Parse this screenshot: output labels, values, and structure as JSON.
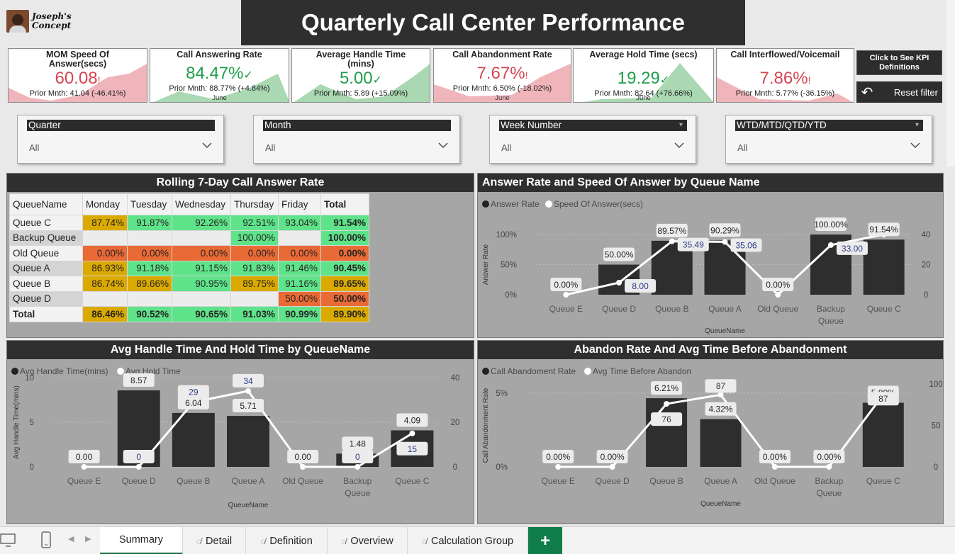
{
  "header": {
    "logo_text_line1": "Joseph's",
    "logo_text_line2": "Concept",
    "title": "Quarterly Call Center Performance"
  },
  "kpis": [
    {
      "title": "MOM Speed Of Answer(secs)",
      "value": "60.08",
      "indicator": "!",
      "status": "bad",
      "prior": "Prior Mnth: 41.04 (-46.41%)",
      "month": ""
    },
    {
      "title": "Call Answering Rate",
      "value": "84.47%",
      "indicator": "✓",
      "status": "good",
      "prior": "Prior Mnth: 88.77% (+4.84%)",
      "month": "June"
    },
    {
      "title": "Average Handle Time (mins)",
      "value": "5.00",
      "indicator": "✓",
      "status": "good",
      "prior": "Prior Mnth: 5.89 (+15.09%)",
      "month": ""
    },
    {
      "title": "Call Abandonment Rate",
      "value": "7.67%",
      "indicator": "!",
      "status": "bad",
      "prior": "Prior Mnth: 6.50% (-18.02%)",
      "month": "June"
    },
    {
      "title": "Average Hold Time (secs)",
      "value": "19.29",
      "indicator": "✓",
      "status": "good",
      "prior": "Prior Mnth: 82.64 (+76.66%)",
      "month": "June"
    },
    {
      "title": "Call Interflowed/Voicemail",
      "value": "7.86%",
      "indicator": "!",
      "status": "bad",
      "prior": "Prior Mnth: 5.77% (-36.15%)",
      "month": ""
    }
  ],
  "buttons": {
    "kpi_definitions": "Click to See KPI Definitions",
    "reset_filter": "Reset filter"
  },
  "slicers": [
    {
      "label": "Quarter",
      "value": "All"
    },
    {
      "label": "Month",
      "value": "All"
    },
    {
      "label": "Week Number",
      "value": "All"
    },
    {
      "label": "WTD/MTD/QTD/YTD",
      "value": "All"
    }
  ],
  "matrix": {
    "title": "Rolling 7-Day Call Answer Rate",
    "columns": [
      "QueueName",
      "Monday",
      "Tuesday",
      "Wednesday",
      "Thursday",
      "Friday",
      "Total"
    ],
    "rows": [
      {
        "name": "Queue C",
        "cells": [
          "87.74%",
          "91.87%",
          "92.26%",
          "92.51%",
          "93.04%",
          "91.54%"
        ],
        "colors": [
          "yellow",
          "green",
          "green",
          "green",
          "green",
          "green"
        ]
      },
      {
        "name": "Backup Queue",
        "cells": [
          "",
          "",
          "",
          "100.00%",
          "",
          "100.00%"
        ],
        "colors": [
          "empty",
          "empty",
          "empty",
          "green",
          "empty",
          "green"
        ]
      },
      {
        "name": "Old Queue",
        "cells": [
          "0.00%",
          "0.00%",
          "0.00%",
          "0.00%",
          "0.00%",
          "0.00%"
        ],
        "colors": [
          "orange",
          "orange",
          "orange",
          "orange",
          "orange",
          "orange"
        ]
      },
      {
        "name": "Queue A",
        "cells": [
          "86.93%",
          "91.18%",
          "91.15%",
          "91.83%",
          "91.46%",
          "90.45%"
        ],
        "colors": [
          "yellow",
          "green",
          "green",
          "green",
          "green",
          "green"
        ]
      },
      {
        "name": "Queue B",
        "cells": [
          "86.74%",
          "89.66%",
          "90.95%",
          "89.75%",
          "91.16%",
          "89.65%"
        ],
        "colors": [
          "yellow",
          "yellow",
          "green",
          "yellow",
          "green",
          "yellow"
        ]
      },
      {
        "name": "Queue D",
        "cells": [
          "",
          "",
          "",
          "",
          "50.00%",
          "50.00%"
        ],
        "colors": [
          "empty",
          "empty",
          "empty",
          "empty",
          "orange",
          "orange"
        ]
      },
      {
        "name": "Total",
        "cells": [
          "86.46%",
          "90.52%",
          "90.65%",
          "91.03%",
          "90.99%",
          "89.90%"
        ],
        "colors": [
          "yellow",
          "green",
          "green",
          "green",
          "green",
          "yellow"
        ]
      }
    ]
  },
  "chart_data": [
    {
      "type": "bar",
      "title": "Answer Rate and Speed Of Answer by Queue Name",
      "legend": [
        "Answer Rate",
        "Speed Of Answer(secs)"
      ],
      "xlabel": "QueueName",
      "ylabel": "Answer Rate",
      "categories": [
        "Queue E",
        "Queue D",
        "Queue B",
        "Queue A",
        "Old Queue",
        "Backup Queue",
        "Queue C"
      ],
      "series": [
        {
          "name": "Answer Rate",
          "kind": "bar",
          "values": [
            0,
            50,
            89.57,
            90.29,
            0,
            100,
            91.54
          ],
          "labels": [
            "0.00%",
            "50.00%",
            "89.57%",
            "90.29%",
            "0.00%",
            "100.00%",
            "91.54%"
          ]
        },
        {
          "name": "Speed Of Answer(secs)",
          "kind": "line",
          "values": [
            0,
            8,
            35.49,
            35.06,
            0,
            33,
            40
          ],
          "labels": [
            "",
            "8.00",
            "35.49",
            "35.06",
            "",
            "33.00",
            ""
          ]
        }
      ],
      "yticks_left": [
        "0%",
        "50%",
        "100%"
      ],
      "yticks_right": [
        "0",
        "20",
        "40"
      ],
      "ylim_left": [
        0,
        100
      ],
      "ylim_right": [
        0,
        40
      ]
    },
    {
      "type": "bar",
      "title": "Avg Handle Time And Hold Time by QueueName",
      "legend": [
        "Avg Handle Time(mins)",
        "Avg Hold Time"
      ],
      "xlabel": "QueueName",
      "ylabel": "Avg Handle Time(mins)",
      "categories": [
        "Queue E",
        "Queue D",
        "Queue B",
        "Queue A",
        "Old Queue",
        "Backup Queue",
        "Queue C"
      ],
      "series": [
        {
          "name": "Avg Handle Time(mins)",
          "kind": "bar",
          "values": [
            0,
            8.57,
            6.04,
            5.71,
            0,
            1.48,
            4.09
          ],
          "labels": [
            "0.00",
            "8.57",
            "6.04",
            "5.71",
            "0.00",
            "1.48",
            "4.09"
          ]
        },
        {
          "name": "Avg Hold Time",
          "kind": "line",
          "values": [
            0,
            0,
            29,
            34,
            0,
            0,
            15
          ],
          "labels": [
            "",
            "0",
            "29",
            "34",
            "",
            "0",
            "15"
          ]
        }
      ],
      "yticks_left": [
        "0",
        "5",
        "10"
      ],
      "yticks_right": [
        "0",
        "20",
        "40"
      ],
      "ylim_left": [
        0,
        10
      ],
      "ylim_right": [
        0,
        40
      ]
    },
    {
      "type": "bar",
      "title": "Abandon Rate And Avg Time Before Abandonment",
      "legend": [
        "Call Abandoment Rate",
        "Avg Time Before Abandon"
      ],
      "xlabel": "QueueName",
      "ylabel": "Call Abandonment Rate",
      "categories": [
        "Queue E",
        "Queue D",
        "Queue B",
        "Queue A",
        "Old Queue",
        "Backup Queue",
        "Queue C"
      ],
      "series": [
        {
          "name": "Call Abandoment Rate",
          "kind": "bar",
          "values": [
            0,
            0,
            6.21,
            4.32,
            0,
            0,
            5.8
          ],
          "labels": [
            "0.00%",
            "0.00%",
            "6.21%",
            "4.32%",
            "0.00%",
            "0.00%",
            "5.80%"
          ]
        },
        {
          "name": "Avg Time Before Abandon",
          "kind": "line",
          "values": [
            0,
            0,
            76,
            87,
            0,
            0,
            87
          ],
          "labels": [
            "",
            "",
            "76",
            "87",
            "",
            "",
            "87"
          ]
        }
      ],
      "yticks_left": [
        "0%",
        "5%"
      ],
      "yticks_right": [
        "0",
        "50",
        "100"
      ],
      "ylim_left": [
        0,
        7.5
      ],
      "ylim_right": [
        0,
        100
      ]
    }
  ],
  "tabs": [
    {
      "label": "Summary",
      "active": true,
      "hidden": false
    },
    {
      "label": "Detail",
      "active": false,
      "hidden": true
    },
    {
      "label": "Definition",
      "active": false,
      "hidden": true
    },
    {
      "label": "Overview",
      "active": false,
      "hidden": true
    },
    {
      "label": "Calculation Group",
      "active": false,
      "hidden": true
    }
  ],
  "colors": {
    "bar": "#2e2e2e",
    "good": "#1e9e4a",
    "bad": "#d64550",
    "tab_add": "#117d4a",
    "accent_green": "#5fe38a",
    "accent_yellow": "#dbaa00",
    "accent_orange": "#ea6a36"
  }
}
